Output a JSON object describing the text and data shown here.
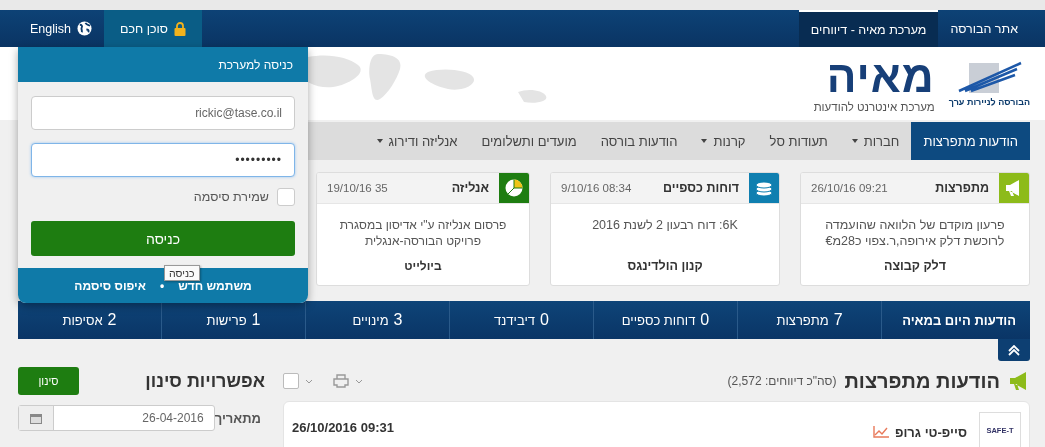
{
  "top_bar": {
    "links": [
      {
        "label": "אתר הבורסה",
        "selected": false
      },
      {
        "label": "מערכת מאיה - דיווחים",
        "selected": true
      }
    ],
    "language": "English",
    "login_tab": {
      "label": "סוכן חכם",
      "selected": true
    }
  },
  "header": {
    "tase_caption": "הבורסה לניירות ערך",
    "logo_title": "מאיה",
    "logo_subtitle": "מערכת אינטרנט להודעות"
  },
  "nav": [
    {
      "label": "הודעות מתפרצות",
      "selected": true,
      "dropdown": false
    },
    {
      "label": "חברות",
      "selected": false,
      "dropdown": true
    },
    {
      "label": "תעודות סל",
      "selected": false,
      "dropdown": false
    },
    {
      "label": "קרנות",
      "selected": false,
      "dropdown": true
    },
    {
      "label": "הודעות בורסה",
      "selected": false,
      "dropdown": false
    },
    {
      "label": "מועדים ותשלומים",
      "selected": false,
      "dropdown": false
    },
    {
      "label": "אנליזה ודירוג",
      "selected": false,
      "dropdown": true
    }
  ],
  "cards": [
    {
      "kind": "breaking",
      "title": "מתפרצות",
      "time": "09:21 26/10/16",
      "lines": [
        "פרעון מוקדם של הלוואה שהועמדה",
        "לרוכשת דלק אירופה,ר.צפוי כ28מ€"
      ],
      "company": "דלק קבוצה",
      "color": "#8dbb1a"
    },
    {
      "kind": "financial",
      "title": "דוחות כספיים",
      "time": "08:34 9/10/16",
      "lines": [
        "6K: דוח רבעון 2 לשנת 2016"
      ],
      "company": "קנון הולדינגס",
      "color": "#0f7fb0"
    },
    {
      "kind": "analysis",
      "title": "אנליזה",
      "time": "35 19/10/16",
      "lines": [
        "פרסום אנליזה ע\"י אדיסון במסגרת",
        "פרויקט הבורסה-אנגלית"
      ],
      "company": "ביולייט",
      "color": "#1e7d11"
    }
  ],
  "today": {
    "title": "הודעות היום במאיה",
    "items": [
      {
        "count": "7",
        "label": "מתפרצות"
      },
      {
        "count": "0",
        "label": "דוחות כספיים"
      },
      {
        "count": "0",
        "label": "דיבידנד"
      },
      {
        "count": "3",
        "label": "מינויים"
      },
      {
        "count": "1",
        "label": "פרישות"
      },
      {
        "count": "2",
        "label": "אסיפות"
      }
    ]
  },
  "reports": {
    "title": "הודעות מתפרצות",
    "total": "(סה\"כ דיווחים: 2,572)",
    "select_all_checked": false,
    "items": [
      {
        "logo_text": "SAFE-T",
        "company": "סייפ-טי גרופ",
        "time": "09:31 26/10/2016"
      }
    ]
  },
  "filter": {
    "title": "אפשרויות סינון",
    "button": "סינון",
    "from_label": "מתאריך",
    "from_date": "26-04-2016"
  },
  "login": {
    "title": "כניסה למערכת",
    "email": "rickic@tase.co.il",
    "password_mask": "•••••••••",
    "remember_label": "שמירת סיסמה",
    "remember_checked": false,
    "submit": "כניסה",
    "tooltip": "כניסה",
    "links": [
      "משתמש חדש",
      "איפוס סיסמה"
    ],
    "separator": "•"
  }
}
